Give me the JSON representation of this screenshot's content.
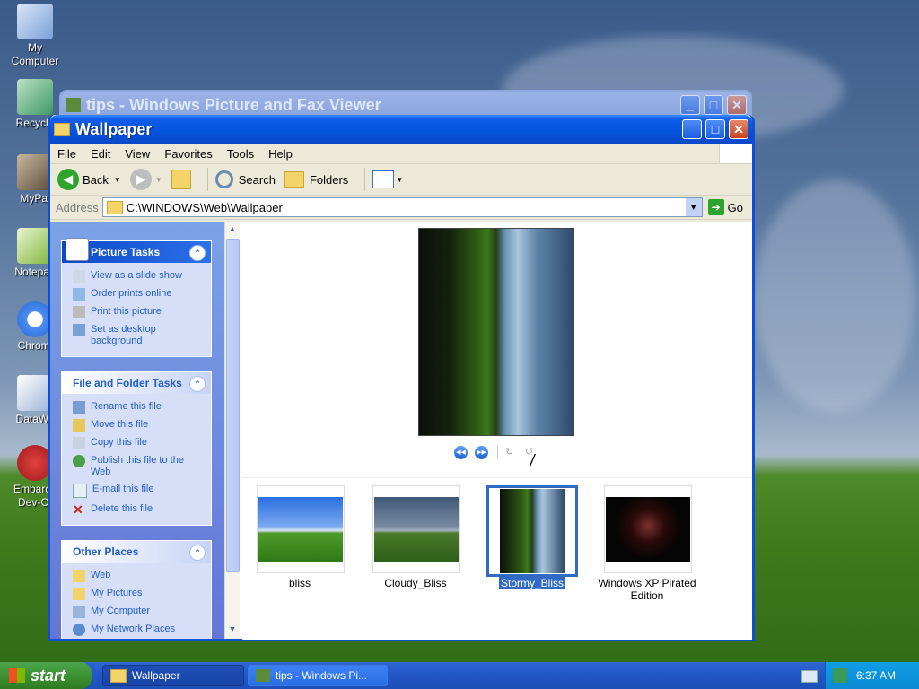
{
  "desktop": {
    "icons": [
      {
        "label": "My\nComputer"
      },
      {
        "label": "Recycle"
      },
      {
        "label": "MyPal"
      },
      {
        "label": "Notepad"
      },
      {
        "label": "Chromi"
      },
      {
        "label": "DataWa"
      },
      {
        "label": "Embarca\nDev-C-"
      }
    ]
  },
  "back_window": {
    "title": "tips - Windows Picture and Fax Viewer"
  },
  "window": {
    "title": "Wallpaper",
    "menus": [
      "File",
      "Edit",
      "View",
      "Favorites",
      "Tools",
      "Help"
    ],
    "toolbar": {
      "back": "Back",
      "search": "Search",
      "folders": "Folders"
    },
    "address": {
      "label": "Address",
      "value": "C:\\WINDOWS\\Web\\Wallpaper",
      "go": "Go"
    }
  },
  "tasks": {
    "picture": {
      "title": "Picture Tasks",
      "items": [
        "View as a slide show",
        "Order prints online",
        "Print this picture",
        "Set as desktop background"
      ]
    },
    "file_folder": {
      "title": "File and Folder Tasks",
      "items": [
        "Rename this file",
        "Move this file",
        "Copy this file",
        "Publish this file to the Web",
        "E-mail this file",
        "Delete this file"
      ]
    },
    "other": {
      "title": "Other Places",
      "items": [
        "Web",
        "My Pictures",
        "My Computer",
        "My Network Places"
      ]
    }
  },
  "files": [
    {
      "name": "bliss",
      "selected": false
    },
    {
      "name": "Cloudy_Bliss",
      "selected": false
    },
    {
      "name": "Stormy_Bliss",
      "selected": true
    },
    {
      "name": "Windows XP Pirated Edition",
      "selected": false
    }
  ],
  "taskbar": {
    "start": "start",
    "tasks": [
      "Wallpaper",
      "tips - Windows Pi..."
    ],
    "clock": "6:37 AM"
  }
}
